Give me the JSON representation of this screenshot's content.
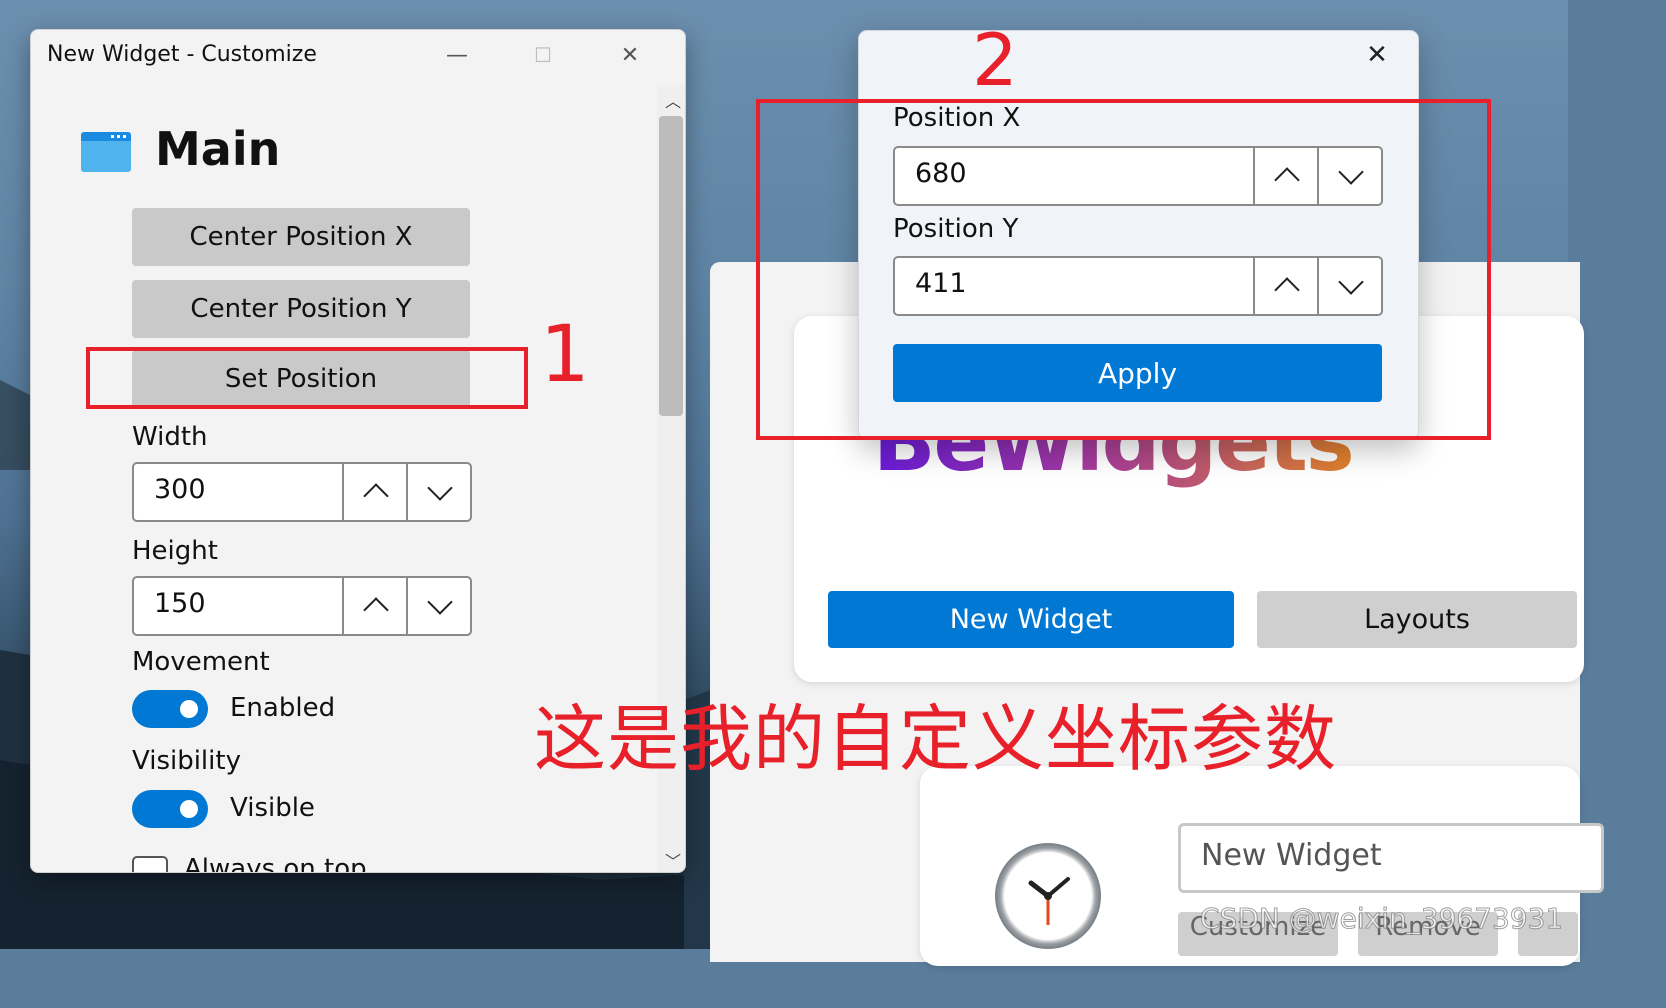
{
  "customize_window": {
    "title": "New Widget - Customize",
    "minimize_glyph": "—",
    "maximize_glyph": "☐",
    "close_glyph": "✕",
    "section_title": "Main",
    "section_icon": "window-icon",
    "buttons": {
      "center_x": "Center Position X",
      "center_y": "Center Position Y",
      "set_position": "Set Position"
    },
    "width": {
      "label": "Width",
      "value": "300"
    },
    "height": {
      "label": "Height",
      "value": "150"
    },
    "movement": {
      "label": "Movement",
      "state": "Enabled",
      "on": true
    },
    "visibility": {
      "label": "Visibility",
      "state": "Visible",
      "on": true
    },
    "always_on_top": {
      "label": "Always on top",
      "checked": false
    }
  },
  "position_dialog": {
    "close_glyph": "✕",
    "position_x": {
      "label": "Position X",
      "value": "680"
    },
    "position_y": {
      "label": "Position Y",
      "value": "411"
    },
    "apply_label": "Apply"
  },
  "bewidgets_window": {
    "brand": "BeWidgets",
    "new_widget_label": "New Widget",
    "layouts_label": "Layouts",
    "widget_name_value": "New Widget",
    "customize_label": "Customize",
    "remove_label": "Remove"
  },
  "annotations": {
    "marker_1": "1",
    "marker_2": "2",
    "caption": "这是我的自定义坐标参数",
    "watermark": "CSDN @weixin_39673931",
    "color": "#e8202a"
  },
  "colors": {
    "accent": "#0078d4",
    "button_gray": "#c9c9c9"
  }
}
